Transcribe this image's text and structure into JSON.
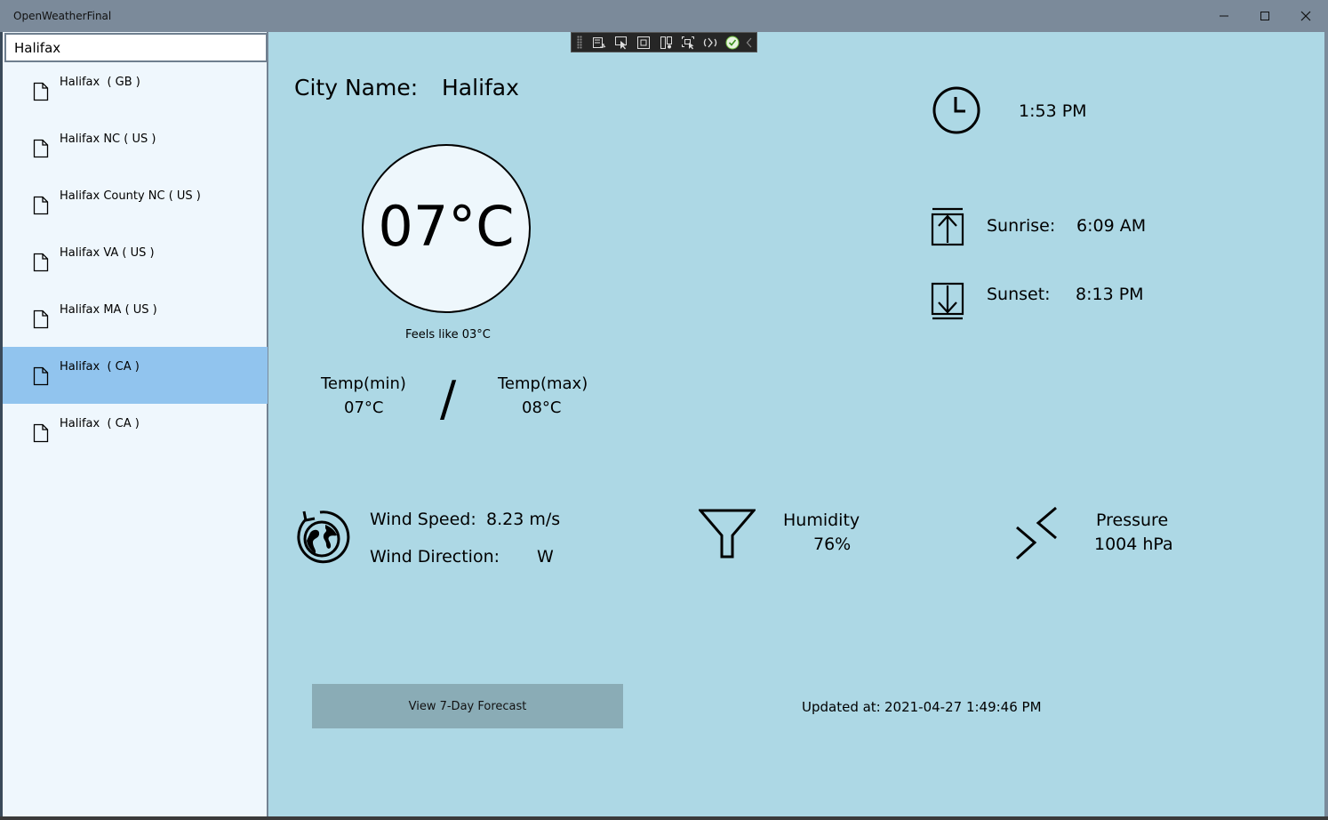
{
  "window": {
    "title": "OpenWeatherFinal"
  },
  "search": {
    "value": "Halifax"
  },
  "results": [
    {
      "label": "Halifax  ( GB )",
      "selected": false
    },
    {
      "label": "Halifax NC ( US )",
      "selected": false
    },
    {
      "label": "Halifax County NC ( US )",
      "selected": false
    },
    {
      "label": "Halifax VA ( US )",
      "selected": false
    },
    {
      "label": "Halifax MA ( US )",
      "selected": false
    },
    {
      "label": "Halifax  ( CA )",
      "selected": true
    },
    {
      "label": "Halifax  ( CA )",
      "selected": false
    }
  ],
  "weather": {
    "city_label": "City Name:",
    "city_value": "Halifax",
    "temp": "07°C",
    "feels_like": "Feels like 03°C",
    "temp_min_label": "Temp(min)",
    "temp_min_value": "07°C",
    "separator": "/",
    "temp_max_label": "Temp(max)",
    "temp_max_value": "08°C",
    "time": "1:53 PM",
    "sunrise_label": "Sunrise:",
    "sunrise_value": "6:09 AM",
    "sunset_label": "Sunset:",
    "sunset_value": "8:13 PM",
    "wind_speed_label": "Wind Speed:",
    "wind_speed_value": "8.23 m/s",
    "wind_direction_label": "Wind Direction:",
    "wind_direction_value": "W",
    "humidity_label": "Humidity",
    "humidity_value": "76%",
    "pressure_label": "Pressure",
    "pressure_value": "1004 hPa",
    "forecast_button": "View 7-Day Forecast",
    "updated_label": "Updated at:",
    "updated_value": "2021-04-27 1:49:46 PM"
  },
  "icons": {
    "window_controls": [
      "minimize-icon",
      "maximize-icon",
      "close-icon"
    ],
    "debug_toolbar": [
      "live-visual-tree-icon",
      "select-element-icon",
      "display-layout-adorners-icon",
      "track-focus-icon",
      "preview-selection-icon",
      "hot-reload-icon",
      "binding-ok-icon",
      "collapse-chevron-icon"
    ],
    "result": "document-icon",
    "time": "clock-icon",
    "sunrise": "sunrise-arrow-up-icon",
    "sunset": "sunset-arrow-down-icon",
    "wind": "globe-refresh-icon",
    "humidity": "funnel-icon",
    "pressure": "pressure-chevrons-icon"
  },
  "colors": {
    "titlebar": "#7b8a9a",
    "sidebar": "#eff7fd",
    "selected": "#91c4ee",
    "main": "#add8e5",
    "button": "#8aacb6"
  }
}
